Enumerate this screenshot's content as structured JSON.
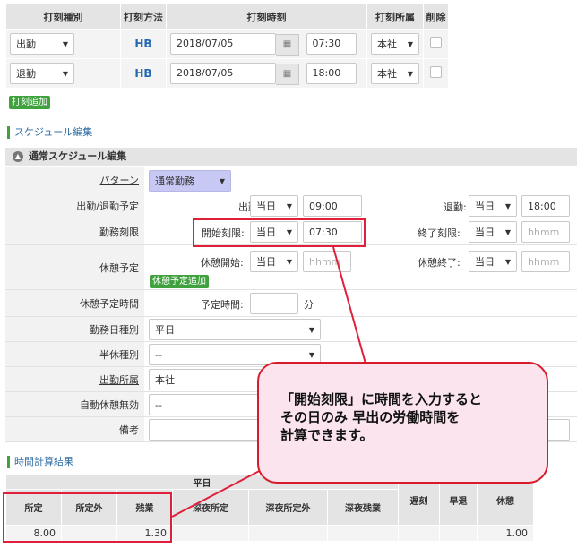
{
  "punch": {
    "headers": [
      "打刻種別",
      "打刻方法",
      "打刻時刻",
      "打刻所属",
      "削除"
    ],
    "rows": [
      {
        "type": "出勤",
        "method": "HB",
        "date": "2018/07/05",
        "time": "07:30",
        "office": "本社"
      },
      {
        "type": "退勤",
        "method": "HB",
        "date": "2018/07/05",
        "time": "18:00",
        "office": "本社"
      }
    ],
    "add_button": "打刻追加"
  },
  "schedule_section_title": "スケジュール編集",
  "schedule": {
    "header": "通常スケジュール編集",
    "pattern_label": "パターン",
    "pattern_value": "通常勤務",
    "commute_label": "出勤/退勤予定",
    "in_label": "出勤:",
    "in_day": "当日",
    "in_time": "09:00",
    "out_label": "退勤:",
    "out_day": "当日",
    "out_time": "18:00",
    "limit_label": "勤務刻限",
    "start_limit_label": "開始刻限:",
    "start_limit_day": "当日",
    "start_limit_time": "07:30",
    "end_limit_label": "終了刻限:",
    "end_limit_day": "当日",
    "end_limit_placeholder": "hhmm",
    "break_label": "休憩予定",
    "break_start_label": "休憩開始:",
    "break_start_day": "当日",
    "break_start_placeholder": "hhmm",
    "break_end_label": "休憩終了:",
    "break_end_day": "当日",
    "break_end_placeholder": "hhmm",
    "break_add_button": "休憩予定追加",
    "break_time_label": "休憩予定時間",
    "planned_time_label": "予定時間:",
    "minutes_unit": "分",
    "workday_label": "勤務日種別",
    "workday_value": "平日",
    "halfday_label": "半休種別",
    "halfday_value": "--",
    "office_label": "出勤所属",
    "office_value": "本社",
    "auto_break_label": "自動休憩無効",
    "auto_break_value": "--",
    "note_label": "備考"
  },
  "result_section_title": "時間計算結果",
  "results": {
    "group_header": "平日",
    "headers": [
      "所定",
      "所定外",
      "残業",
      "深夜所定",
      "深夜所定外",
      "深夜残業",
      "遅刻",
      "早退",
      "休憩"
    ],
    "values": [
      "8.00",
      "",
      "1.30",
      "",
      "",
      "",
      "",
      "",
      "1.00"
    ]
  },
  "callout": {
    "line1": "「開始刻限」に時間を入力すると",
    "line2": "その日のみ 早出の労働時間を",
    "line3": "計算できます。"
  },
  "colors": {
    "highlight_red": "#e0203a",
    "callout_fill": "#fbe4ee",
    "button_green": "#3fa23f",
    "pattern_fill": "#c8c8f4"
  }
}
